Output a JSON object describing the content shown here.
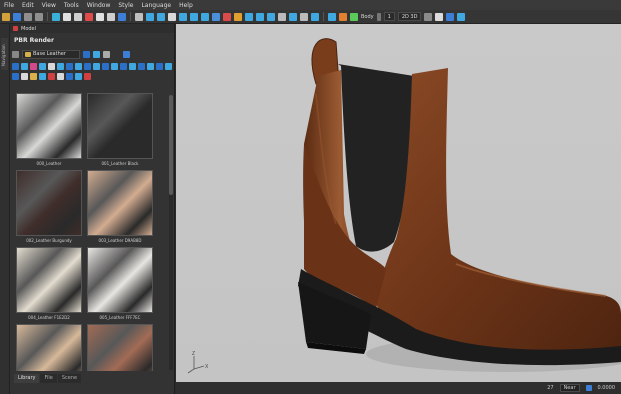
{
  "menu": [
    "File",
    "Edit",
    "View",
    "Tools",
    "Window",
    "Style",
    "Language",
    "Help"
  ],
  "toolbar": {
    "body_label": "Body",
    "num_label": "1",
    "view_label": "2D 3D"
  },
  "side_tab": "Navigation",
  "panel": {
    "header_title": "Model",
    "title": "PBR Render",
    "path": "Base Leather"
  },
  "materials": [
    {
      "name": "000_Leather",
      "color": "#d8d8d6"
    },
    {
      "name": "001_Leather Black",
      "color": "#2a2a2a"
    },
    {
      "name": "002_Leather Burgundy",
      "color": "#3f2d2a"
    },
    {
      "name": "003_Leather D9AB8D",
      "color": "#d2ac90"
    },
    {
      "name": "004_Leather F1E2D2",
      "color": "#e3dccf"
    },
    {
      "name": "005_Leather FFF7EC",
      "color": "#e8e6e2"
    },
    {
      "name": "",
      "color": "#d7b99a"
    },
    {
      "name": "",
      "color": "#a26b55"
    }
  ],
  "tabs": [
    "Library",
    "File",
    "Scene"
  ],
  "status": {
    "value": "27",
    "mode": "Near",
    "zoom": "0.0000"
  },
  "axis": {
    "z": "Z",
    "x": "X"
  }
}
